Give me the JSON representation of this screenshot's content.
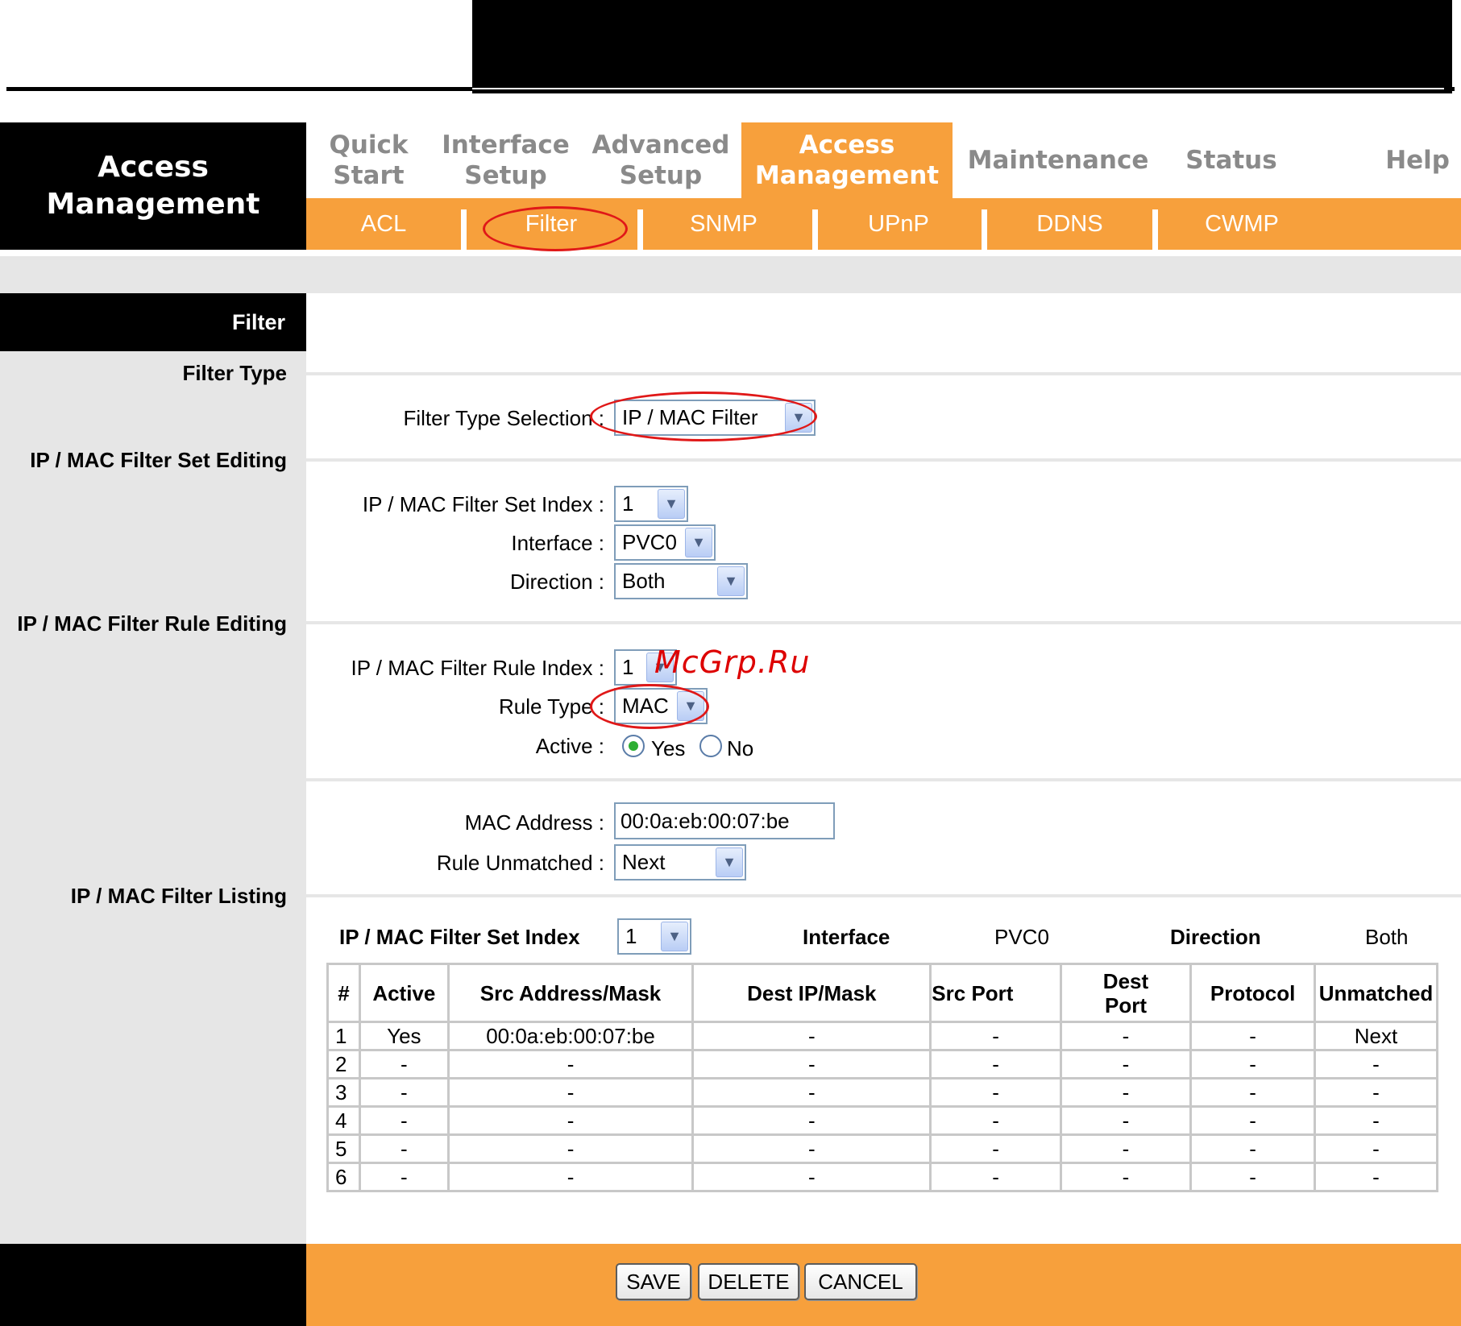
{
  "header": {
    "section_title_line1": "Access",
    "section_title_line2": "Management",
    "tabs": [
      {
        "label": "Quick\nStart"
      },
      {
        "label": "Interface\nSetup"
      },
      {
        "label": "Advanced\nSetup"
      },
      {
        "label": "Access\nManagement"
      },
      {
        "label": "Maintenance"
      },
      {
        "label": "Status"
      },
      {
        "label": "Help"
      }
    ],
    "subtabs": [
      {
        "label": "ACL"
      },
      {
        "label": "Filter"
      },
      {
        "label": "SNMP"
      },
      {
        "label": "UPnP"
      },
      {
        "label": "DDNS"
      },
      {
        "label": "CWMP"
      }
    ]
  },
  "sidebar": {
    "title": "Filter",
    "filter_type": "Filter Type",
    "set_editing": "IP / MAC Filter Set Editing",
    "rule_editing": "IP / MAC Filter Rule Editing",
    "listing": "IP / MAC Filter Listing"
  },
  "form": {
    "filter_type_label": "Filter Type Selection :",
    "filter_type_value": "IP / MAC Filter",
    "set_index_label": "IP / MAC Filter Set Index :",
    "set_index_value": "1",
    "interface_label": "Interface :",
    "interface_value": "PVC0",
    "direction_label": "Direction :",
    "direction_value": "Both",
    "rule_index_label": "IP / MAC Filter Rule Index :",
    "rule_index_value": "1",
    "rule_type_label": "Rule Type :",
    "rule_type_value": "MAC",
    "active_label": "Active :",
    "active_yes": "Yes",
    "active_no": "No",
    "mac_label": "MAC Address :",
    "mac_value": "00:0a:eb:00:07:be",
    "unmatched_label": "Rule Unmatched :",
    "unmatched_value": "Next"
  },
  "listing": {
    "set_index_label": "IP / MAC Filter Set Index",
    "set_index_value": "1",
    "interface_label": "Interface",
    "interface_value": "PVC0",
    "direction_label": "Direction",
    "direction_value": "Both",
    "columns": [
      "#",
      "Active",
      "Src Address/Mask",
      "Dest IP/Mask",
      "Src Port",
      "Dest\nPort",
      "Protocol",
      "Unmatched"
    ],
    "rows": [
      [
        "1",
        "Yes",
        "00:0a:eb:00:07:be",
        "-",
        "-",
        "-",
        "-",
        "Next"
      ],
      [
        "2",
        "-",
        "-",
        "-",
        "-",
        "-",
        "-",
        "-"
      ],
      [
        "3",
        "-",
        "-",
        "-",
        "-",
        "-",
        "-",
        "-"
      ],
      [
        "4",
        "-",
        "-",
        "-",
        "-",
        "-",
        "-",
        "-"
      ],
      [
        "5",
        "-",
        "-",
        "-",
        "-",
        "-",
        "-",
        "-"
      ],
      [
        "6",
        "-",
        "-",
        "-",
        "-",
        "-",
        "-",
        "-"
      ]
    ]
  },
  "buttons": {
    "save": "SAVE",
    "delete": "DELETE",
    "cancel": "CANCEL"
  },
  "watermark": "McGrp.Ru",
  "colors": {
    "accent": "#f7a03c",
    "highlight": "#e01818",
    "panel": "#e6e6e6"
  }
}
